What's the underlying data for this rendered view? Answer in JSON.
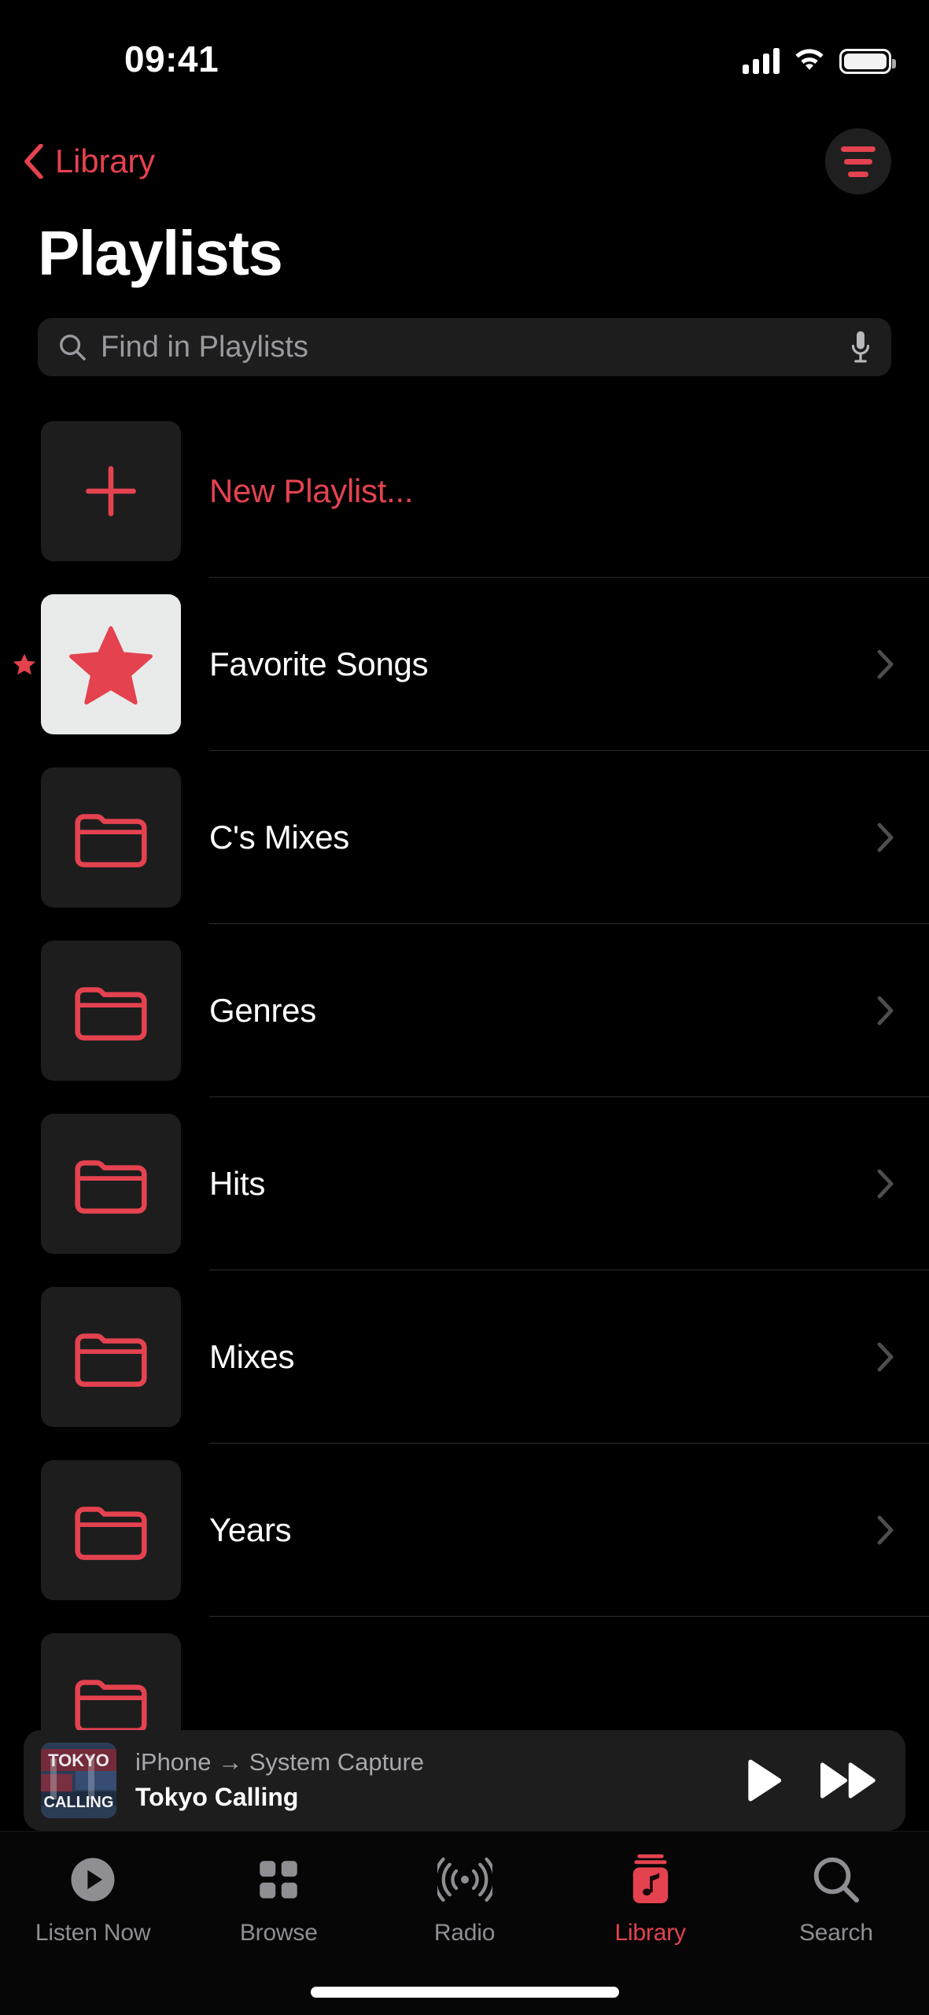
{
  "status_bar": {
    "time": "09:41",
    "cellular_icon": "cellular-signal-icon",
    "wifi_icon": "wifi-icon",
    "battery_icon": "battery-full-icon"
  },
  "nav": {
    "back_label": "Library",
    "back_icon": "chevron-left-icon",
    "sort_icon": "sort-filter-icon"
  },
  "header": {
    "title": "Playlists"
  },
  "search": {
    "placeholder": "Find in Playlists",
    "value": "",
    "search_icon": "search-icon",
    "mic_icon": "microphone-icon"
  },
  "colors": {
    "accent_red": "#e4424f",
    "background": "#000000",
    "thumb_background": "#1d1d1e",
    "favorite_thumb_background": "#e9ebea",
    "secondary_text": "#8e8e93",
    "separator": "#2b2b2c"
  },
  "playlists": [
    {
      "label": "New Playlist...",
      "icon": "plus-icon",
      "accent": true,
      "chevron": false,
      "thumb": "dark",
      "marker": false
    },
    {
      "label": "Favorite Songs",
      "icon": "star-icon",
      "accent": false,
      "chevron": true,
      "thumb": "light",
      "marker": true
    },
    {
      "label": "C's Mixes",
      "icon": "folder-icon",
      "accent": false,
      "chevron": true,
      "thumb": "dark",
      "marker": false
    },
    {
      "label": "Genres",
      "icon": "folder-icon",
      "accent": false,
      "chevron": true,
      "thumb": "dark",
      "marker": false
    },
    {
      "label": "Hits",
      "icon": "folder-icon",
      "accent": false,
      "chevron": true,
      "thumb": "dark",
      "marker": false
    },
    {
      "label": "Mixes",
      "icon": "folder-icon",
      "accent": false,
      "chevron": true,
      "thumb": "dark",
      "marker": false
    },
    {
      "label": "Years",
      "icon": "folder-icon",
      "accent": false,
      "chevron": true,
      "thumb": "dark",
      "marker": false
    }
  ],
  "now_playing": {
    "route": "iPhone → System Capture",
    "title": "Tokyo Calling",
    "artwork_text": "TOKYO CALLING",
    "play_icon": "play-icon",
    "forward_icon": "fast-forward-icon"
  },
  "tabs": [
    {
      "label": "Listen Now",
      "icon": "play-circle-icon",
      "active": false
    },
    {
      "label": "Browse",
      "icon": "grid-squares-icon",
      "active": false
    },
    {
      "label": "Radio",
      "icon": "broadcast-waves-icon",
      "active": false
    },
    {
      "label": "Library",
      "icon": "music-library-icon",
      "active": true
    },
    {
      "label": "Search",
      "icon": "search-icon",
      "active": false
    }
  ]
}
